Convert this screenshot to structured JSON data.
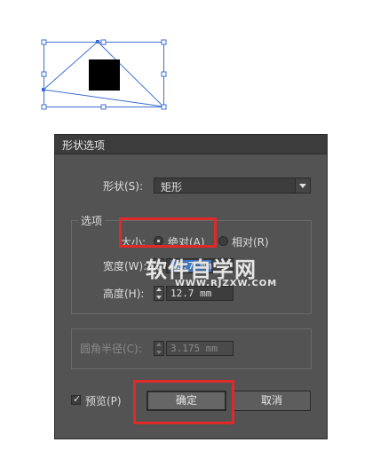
{
  "dialog": {
    "title": "形状选项",
    "shape_label": "形状(S):",
    "shape_value": "矩形",
    "options_group": "选项",
    "size_label": "大小:",
    "absolute_label": "绝对(A)",
    "relative_label": "相对(R)",
    "width_label": "宽度(W):",
    "width_value": "12.7 mm",
    "height_label": "高度(H):",
    "height_value": "12.7 mm",
    "corner_radius_label": "圆角半径(C):",
    "corner_radius_value": "3.175 mm",
    "preview_label": "预览(P)",
    "preview_checked": true,
    "ok_label": "确定",
    "cancel_label": "取消",
    "size_mode": "absolute"
  },
  "watermark": {
    "text": "软件自学网",
    "url": "WWW.RJZXW.COM"
  },
  "colors": {
    "dialog_bg": "#535353",
    "highlight_red": "#e02a2a",
    "selection_blue": "#3d78c8",
    "path_blue": "#3f6fd0"
  }
}
